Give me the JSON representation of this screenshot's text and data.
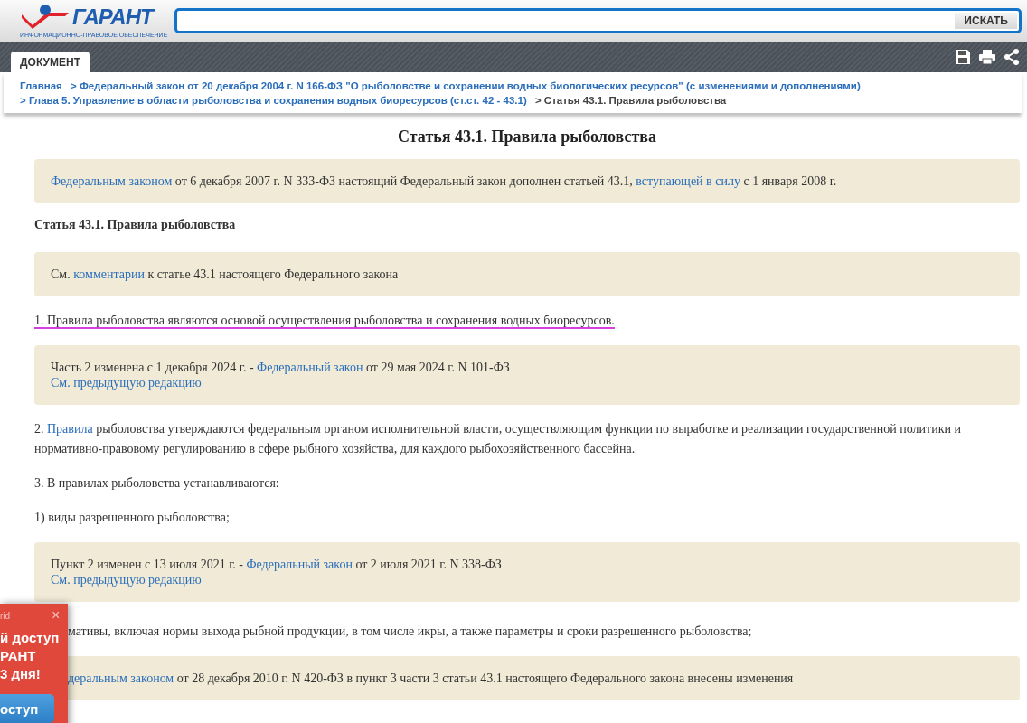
{
  "header": {
    "logo_name": "ГАРАНТ",
    "logo_tagline": "ИНФОРМАЦИОННО-ПРАВОВОЕ ОБЕСПЕЧЕНИЕ",
    "search_button": "ИСКАТЬ"
  },
  "tabs": [
    {
      "label": "ДОКУМЕНТ",
      "selected": true
    }
  ],
  "breadcrumb": [
    {
      "text": "Главная",
      "current": false
    },
    {
      "text": "> Федеральный закон от 20 декабря 2004 г. N 166-ФЗ \"О рыболовстве и сохранении водных биологических ресурсов\" (с изменениями и дополнениями)",
      "current": false
    },
    {
      "text": "> Глава 5. Управление в области рыболовства и сохранения водных биоресурсов (ст.ст. 42 - 43.1)",
      "current": false
    },
    {
      "text": "> Статья 43.1. Правила рыболовства",
      "current": true
    }
  ],
  "title": "Статья 43.1. Правила рыболовства",
  "blocks": [
    {
      "kind": "note",
      "covered": false,
      "lines": [
        [
          {
            "text": "Федеральным законом",
            "kind": "link"
          },
          {
            "text": " от 6 декабря 2007 г. N 333-ФЗ настоящий Федеральный закон дополнен статьей 43.1, ",
            "kind": "text"
          },
          {
            "text": "вступающей в силу",
            "kind": "link"
          },
          {
            "text": " с 1 января 2008 г.",
            "kind": "text"
          }
        ]
      ]
    },
    {
      "kind": "heading",
      "covered": false,
      "lines": [
        [
          {
            "text": "Статья 43.1. Правила рыболовства",
            "kind": "text"
          }
        ]
      ]
    },
    {
      "kind": "note",
      "covered": false,
      "lines": [
        [
          {
            "text": "См. ",
            "kind": "text"
          },
          {
            "text": "комментарии",
            "kind": "link"
          },
          {
            "text": " к статье 43.1 настоящего Федерального закона",
            "kind": "text"
          }
        ]
      ]
    },
    {
      "kind": "paragraph",
      "covered": false,
      "highlighted": true,
      "lines": [
        [
          {
            "text": "1. Правила рыболовства являются основой осуществления рыболовства и сохранения водных биоресурсов.",
            "kind": "text"
          }
        ]
      ]
    },
    {
      "kind": "note",
      "covered": false,
      "lines": [
        [
          {
            "text": "Часть 2 изменена с 1 декабря 2024 г. - ",
            "kind": "text"
          },
          {
            "text": "Федеральный закон",
            "kind": "link"
          },
          {
            "text": " от 29 мая 2024 г. N 101-ФЗ",
            "kind": "text"
          }
        ],
        [
          {
            "text": "См. предыдущую редакцию",
            "kind": "link"
          }
        ]
      ]
    },
    {
      "kind": "paragraph",
      "covered": false,
      "highlighted": false,
      "lines": [
        [
          {
            "text": "2. ",
            "kind": "text"
          },
          {
            "text": "Правила",
            "kind": "link"
          },
          {
            "text": " рыболовства утверждаются федеральным органом исполнительной власти, осуществляющим функции по выработке и реализации государственной политики и нормативно-правовому регулированию в сфере рыбного хозяйства, для каждого рыбохозяйственного бассейна.",
            "kind": "text"
          }
        ]
      ]
    },
    {
      "kind": "paragraph",
      "covered": false,
      "highlighted": false,
      "lines": [
        [
          {
            "text": "3. В правилах рыболовства устанавливаются:",
            "kind": "text"
          }
        ]
      ]
    },
    {
      "kind": "paragraph",
      "covered": false,
      "highlighted": false,
      "lines": [
        [
          {
            "text": "1) виды разрешенного рыболовства;",
            "kind": "text"
          }
        ]
      ]
    },
    {
      "kind": "note",
      "covered": false,
      "lines": [
        [
          {
            "text": "Пункт 2 изменен с 13 июля 2021 г. - ",
            "kind": "text"
          },
          {
            "text": "Федеральный закон",
            "kind": "link"
          },
          {
            "text": " от 2 июля 2021 г. N 338-ФЗ",
            "kind": "text"
          }
        ],
        [
          {
            "text": "См. предыдущую редакцию",
            "kind": "link"
          }
        ]
      ]
    },
    {
      "kind": "paragraph",
      "covered": true,
      "highlighted": false,
      "lines": [
        [
          {
            "text": "мативы, включая нормы выхода рыбной продукции, в том числе икры, а также параметры и сроки разрешенного рыболовства;",
            "kind": "text"
          }
        ]
      ]
    },
    {
      "kind": "note",
      "covered": true,
      "lines": [
        [
          {
            "text": "деральным законом",
            "kind": "link"
          },
          {
            "text": " от 28 декабря 2010 г. N 420-ФЗ в пункт 3 части 3 статьи 43.1 настоящего Федерального закона внесены изменения",
            "kind": "text"
          }
        ]
      ]
    }
  ],
  "popup": {
    "brand": "rid",
    "close": "×",
    "lines": [
      "й доступ",
      "РАНТ",
      "3 дня!"
    ],
    "button": "оступ"
  }
}
